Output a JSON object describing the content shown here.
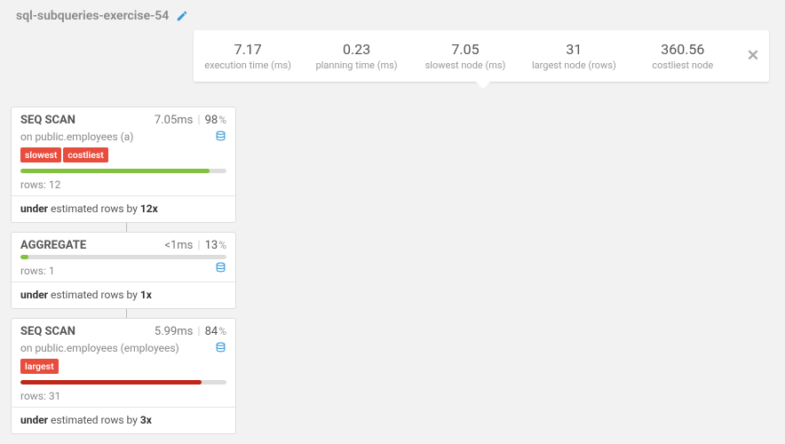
{
  "title": "sql-subqueries-exercise-54",
  "stats": [
    {
      "value": "7.17",
      "label": "execution time (ms)"
    },
    {
      "value": "0.23",
      "label": "planning time (ms)"
    },
    {
      "value": "7.05",
      "label": "slowest node (ms)"
    },
    {
      "value": "31",
      "label": "largest node (rows)"
    },
    {
      "value": "360.56",
      "label": "costliest node"
    }
  ],
  "nodes": [
    {
      "name": "SEQ SCAN",
      "ms": "7.05ms",
      "pct": "98",
      "on": "on public.employees (a)",
      "show_on": true,
      "show_db_head": true,
      "tags": [
        "slowest",
        "costliest"
      ],
      "bar_class": "bar-green",
      "bar_width": "92%",
      "bar_db": false,
      "rows": "rows: 12",
      "est_prefix": "under",
      "est_mid": " estimated rows by ",
      "est_factor": "12x"
    },
    {
      "name": "AGGREGATE",
      "ms": "<1ms",
      "pct": "13",
      "on": "",
      "show_on": false,
      "show_db_head": false,
      "tags": [],
      "bar_class": "bar-greensm",
      "bar_width": "4%",
      "bar_db": true,
      "rows": "rows: 1",
      "est_prefix": "under",
      "est_mid": " estimated rows by ",
      "est_factor": "1x"
    },
    {
      "name": "SEQ SCAN",
      "ms": "5.99ms",
      "pct": "84",
      "on": "on public.employees (employees)",
      "show_on": true,
      "show_db_head": true,
      "tags": [
        "largest"
      ],
      "bar_class": "bar-dark",
      "bar_width": "88%",
      "bar_db": false,
      "rows": "rows: 31",
      "est_prefix": "under",
      "est_mid": " estimated rows by ",
      "est_factor": "3x"
    }
  ]
}
